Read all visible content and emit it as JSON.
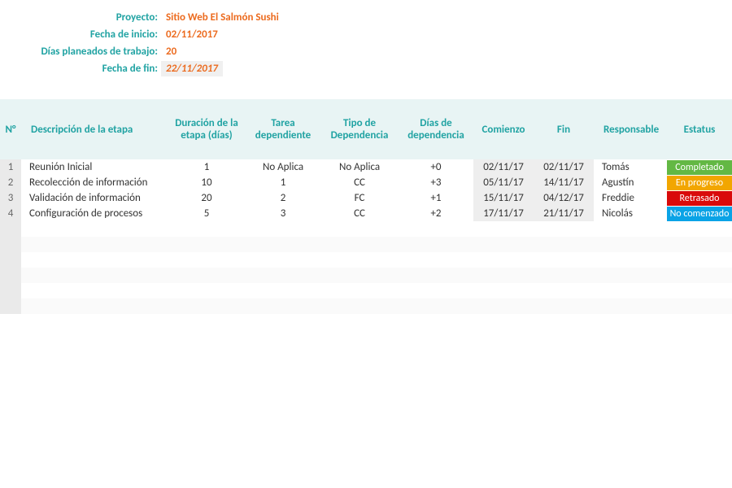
{
  "summary": {
    "labels": {
      "project": "Proyecto:",
      "start": "Fecha de inicio:",
      "planned_days": "Días planeados de trabajo:",
      "end": "Fecha de fin:"
    },
    "values": {
      "project": "Sitio Web El Salmón Sushi",
      "start": "02/11/2017",
      "planned_days": "20",
      "end": "22/11/2017"
    }
  },
  "table": {
    "headers": {
      "num": "N°",
      "desc": "Descripción de la etapa",
      "dur": "Duración de la etapa (días)",
      "dep": "Tarea dependiente",
      "dep_type": "Tipo de Dependencia",
      "dep_days": "Días de dependencia",
      "start": "Comienzo",
      "end": "Fin",
      "resp": "Responsable",
      "status": "Estatus"
    },
    "rows": [
      {
        "num": "1",
        "desc": "Reunión Inicial",
        "dur": "1",
        "dep": "No Aplica",
        "dep_type": "No Aplica",
        "dep_days": "+0",
        "start": "02/11/17",
        "end": "02/11/17",
        "resp": "Tomás",
        "status": "Completado",
        "status_color": "#63b844"
      },
      {
        "num": "2",
        "desc": "Recolección de información",
        "dur": "10",
        "dep": "1",
        "dep_type": "CC",
        "dep_days": "+3",
        "start": "05/11/17",
        "end": "14/11/17",
        "resp": "Agustín",
        "status": "En progreso",
        "status_color": "#f2a600"
      },
      {
        "num": "3",
        "desc": "Validación de información",
        "dur": "20",
        "dep": "2",
        "dep_type": "FC",
        "dep_days": "+1",
        "start": "15/11/17",
        "end": "04/12/17",
        "resp": "Freddie",
        "status": "Retrasado",
        "status_color": "#d90a0a"
      },
      {
        "num": "4",
        "desc": "Configuración de procesos",
        "dur": "5",
        "dep": "3",
        "dep_type": "CC",
        "dep_days": "+2",
        "start": "17/11/17",
        "end": "21/11/17",
        "resp": "Nicolás",
        "status": "No comenzado",
        "status_color": "#0aa3e6"
      }
    ],
    "empty_rows": 6
  }
}
